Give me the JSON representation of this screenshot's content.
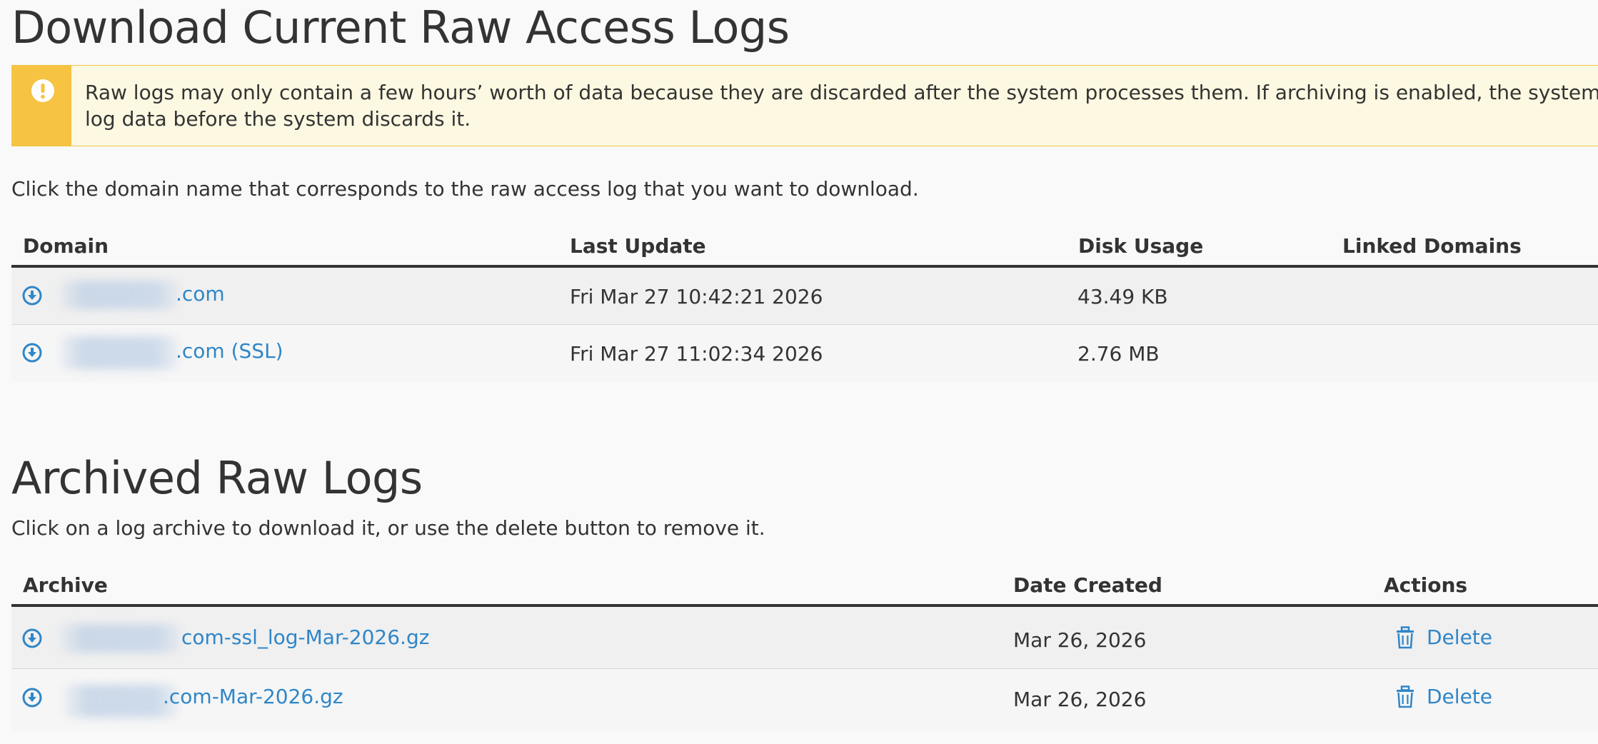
{
  "current": {
    "title": "Download Current Raw Access Logs",
    "alert": {
      "icon": "exclamation-icon",
      "line1": "Raw logs may only contain a few hours’ worth of data because they are discarded after the system processes them. If archiving is enabled, the system archives the r",
      "line2": "log data before the system discards it."
    },
    "intro": "Click the domain name that corresponds to the raw access log that you want to download.",
    "columns": {
      "domain": "Domain",
      "last_update": "Last Update",
      "disk_usage": "Disk Usage",
      "linked_domains": "Linked Domains"
    },
    "rows": [
      {
        "domain": ".com",
        "last_update": "Fri Mar 27 10:42:21 2026",
        "disk_usage": "43.49 KB",
        "linked_domains": ""
      },
      {
        "domain": ".com (SSL)",
        "last_update": "Fri Mar 27 11:02:34 2026",
        "disk_usage": "2.76 MB",
        "linked_domains": ""
      }
    ]
  },
  "archived": {
    "title": "Archived Raw Logs",
    "intro": "Click on a log archive to download it, or use the delete button to remove it.",
    "columns": {
      "archive": "Archive",
      "date_created": "Date Created",
      "actions": "Actions"
    },
    "rows": [
      {
        "archive": "com-ssl_log-Mar-2026.gz",
        "date_created": "Mar 26, 2026",
        "action": "Delete"
      },
      {
        "archive": ".com-Mar-2026.gz",
        "date_created": "Mar 26, 2026",
        "action": "Delete"
      }
    ]
  },
  "colors": {
    "link": "#2f86c8",
    "alert_bg": "#fcf8e1",
    "alert_accent": "#f6c342",
    "text": "#333333"
  }
}
